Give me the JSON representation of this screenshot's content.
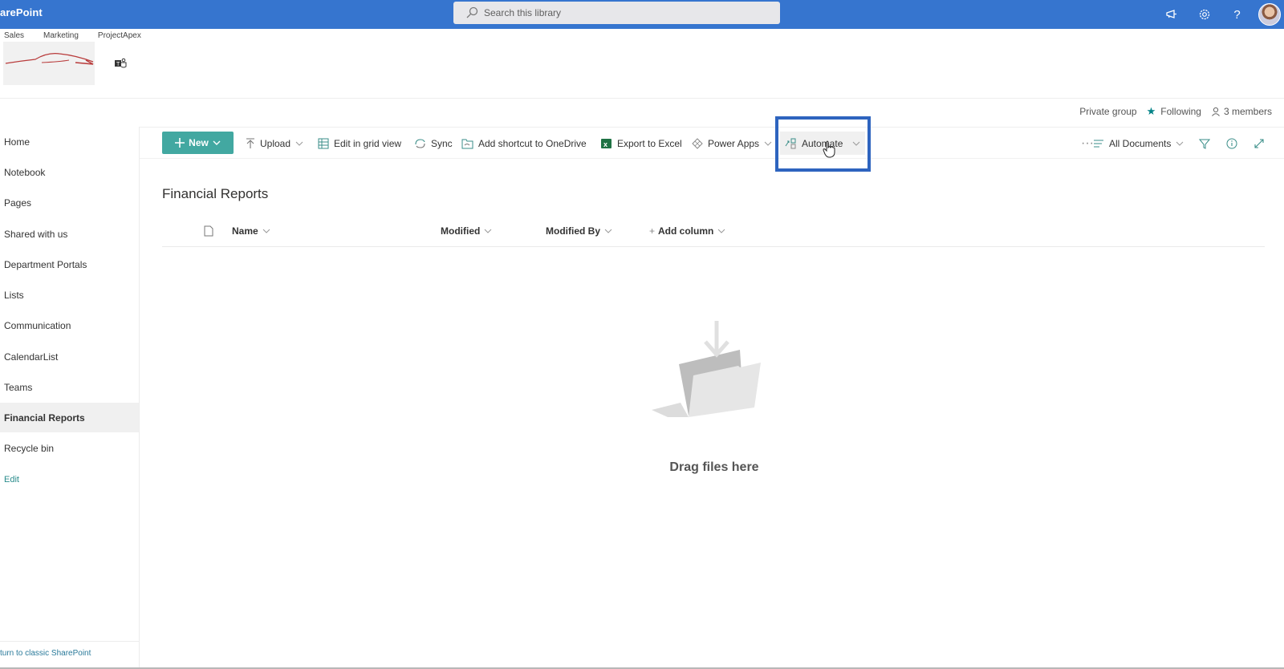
{
  "suite": {
    "brand": "arePoint",
    "search_placeholder": "Search this library",
    "icons": [
      "megaphone-icon",
      "gear-icon",
      "help-icon",
      "avatar"
    ]
  },
  "hubnav": [
    "Sales",
    "Marketing",
    "ProjectApex"
  ],
  "group_info": {
    "privacy": "Private group",
    "following": "Following",
    "members": "3 members"
  },
  "leftnav": {
    "items": [
      {
        "label": "Home"
      },
      {
        "label": "Notebook"
      },
      {
        "label": "Pages"
      },
      {
        "label": "Shared with us"
      },
      {
        "label": "Department Portals"
      },
      {
        "label": "Lists"
      },
      {
        "label": "Communication"
      },
      {
        "label": "CalendarList"
      },
      {
        "label": "Teams"
      },
      {
        "label": "Financial Reports",
        "active": true
      },
      {
        "label": "Recycle bin"
      }
    ],
    "edit": "Edit",
    "classic": "turn to classic SharePoint"
  },
  "commandbar": {
    "new": "New",
    "upload": "Upload",
    "edit_grid": "Edit in grid view",
    "sync": "Sync",
    "add_shortcut": "Add shortcut to OneDrive",
    "export_excel": "Export to Excel",
    "power_apps": "Power Apps",
    "automate": "Automate",
    "more": "···",
    "view": "All Documents"
  },
  "library": {
    "title": "Financial Reports",
    "columns": [
      "Name",
      "Modified",
      "Modified By",
      "Add column"
    ],
    "empty_text": "Drag files here"
  },
  "colors": {
    "suitebar": "#3675cf",
    "accent": "#42a8a1",
    "highlight": "#2e64bf"
  }
}
